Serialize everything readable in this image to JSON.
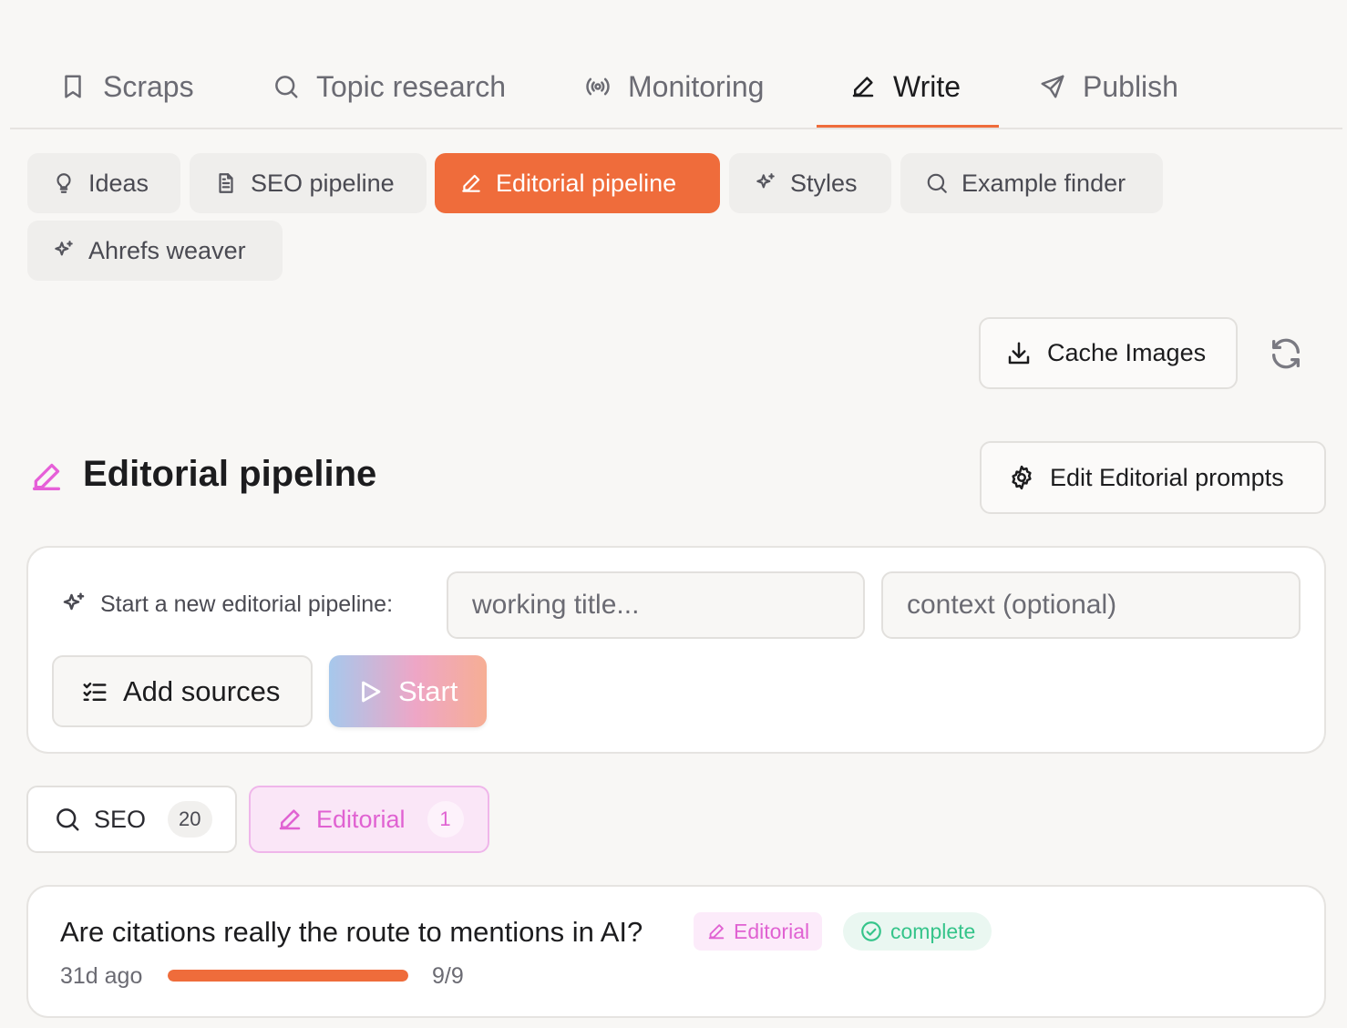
{
  "nav": {
    "tabs": [
      {
        "label": "Scraps",
        "icon": "bookmark-icon"
      },
      {
        "label": "Topic research",
        "icon": "search-icon"
      },
      {
        "label": "Monitoring",
        "icon": "broadcast-icon"
      },
      {
        "label": "Write",
        "icon": "pen-icon",
        "active": true
      },
      {
        "label": "Publish",
        "icon": "send-icon"
      }
    ],
    "accent_color": "#ef6c3b"
  },
  "subnav": {
    "items": [
      {
        "label": "Ideas",
        "icon": "lightbulb-icon"
      },
      {
        "label": "SEO pipeline",
        "icon": "document-icon"
      },
      {
        "label": "Editorial pipeline",
        "icon": "pen-icon",
        "active": true
      },
      {
        "label": "Styles",
        "icon": "sparkles-icon"
      },
      {
        "label": "Example finder",
        "icon": "search-icon"
      },
      {
        "label": "Ahrefs weaver",
        "icon": "sparkles-icon"
      }
    ]
  },
  "toolbar": {
    "cache_images_label": "Cache Images",
    "refresh_icon": "refresh-icon"
  },
  "section": {
    "title": "Editorial pipeline",
    "icon": "pen-icon",
    "icon_color": "#e65fd8",
    "edit_prompts_label": "Edit Editorial prompts"
  },
  "new_pipeline": {
    "label": "Start a new editorial pipeline:",
    "title_placeholder": "working title...",
    "context_placeholder": "context (optional)",
    "add_sources_label": "Add sources",
    "start_label": "Start"
  },
  "filters": [
    {
      "label": "SEO",
      "count": "20",
      "icon": "search-icon"
    },
    {
      "label": "Editorial",
      "count": "1",
      "icon": "pen-icon",
      "active": true
    }
  ],
  "pipelines": [
    {
      "title": "Are citations really the route to mentions in AI?",
      "type_badge": "Editorial",
      "status": "complete",
      "status_color": "#35c48a",
      "age": "31d ago",
      "progress_text": "9/9",
      "progress_fraction": 1.0
    }
  ]
}
